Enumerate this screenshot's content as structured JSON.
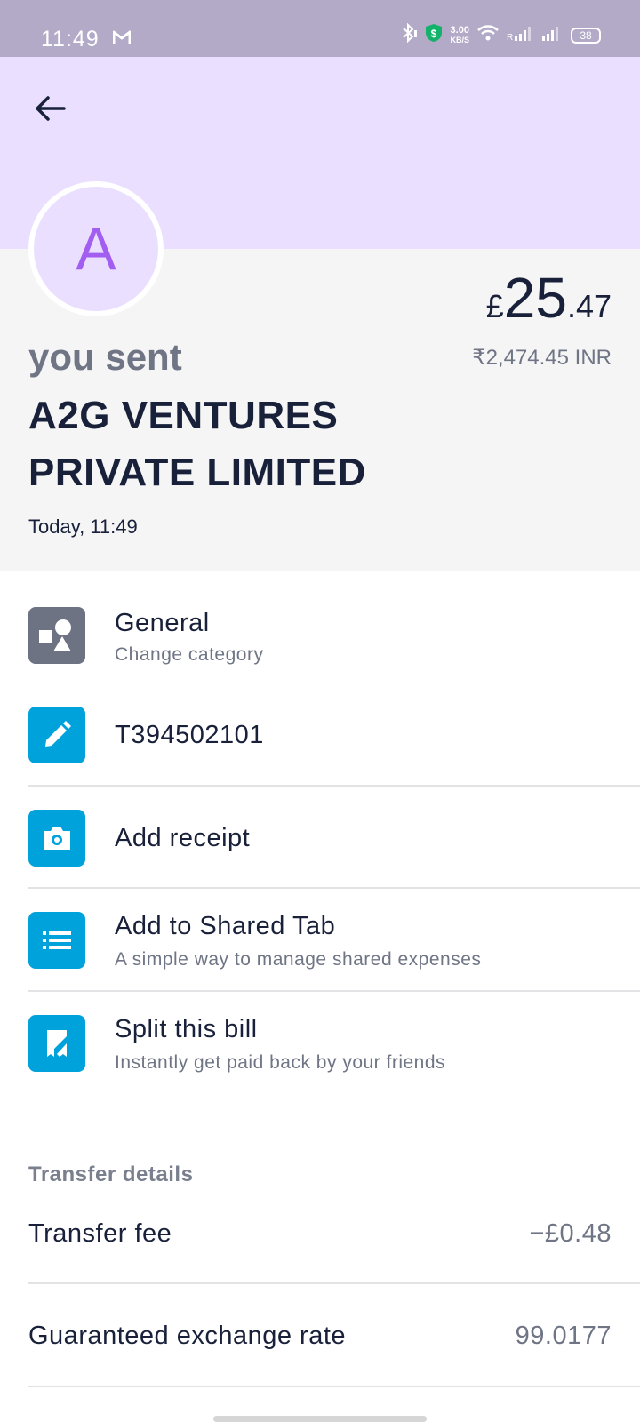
{
  "status_bar": {
    "time": "11:49",
    "speed_value": "3.00",
    "speed_unit": "KB/S",
    "battery": "38"
  },
  "header": {
    "avatar_letter": "A",
    "you_sent": "you sent",
    "recipient": "A2G VENTURES PRIVATE LIMITED",
    "date": "Today, 11:49",
    "amount_currency": "£",
    "amount_main": "25",
    "amount_decimal": ".47",
    "amount_inr": "₹2,474.45 INR"
  },
  "actions": [
    {
      "title": "General",
      "subtitle": "Change category",
      "icon": "shapes-icon"
    },
    {
      "title": "T394502101",
      "subtitle": "",
      "icon": "pencil-icon"
    },
    {
      "title": "Add receipt",
      "subtitle": "",
      "icon": "camera-icon"
    },
    {
      "title": "Add to Shared Tab",
      "subtitle": "A simple way to manage shared expenses",
      "icon": "list-icon"
    },
    {
      "title": "Split this bill",
      "subtitle": "Instantly get paid back by your friends",
      "icon": "split-bill-icon"
    }
  ],
  "transfer_details": {
    "title": "Transfer details",
    "rows": [
      {
        "label": "Transfer fee",
        "value": "−£0.48"
      },
      {
        "label": "Guaranteed exchange rate",
        "value": "99.0177"
      }
    ]
  },
  "colors": {
    "status_bar": "#b3aac8",
    "header": "#ebdfff",
    "avatar_letter": "#a25ef0",
    "icon_blue": "#00a2dc",
    "icon_grey": "#6d7383"
  }
}
